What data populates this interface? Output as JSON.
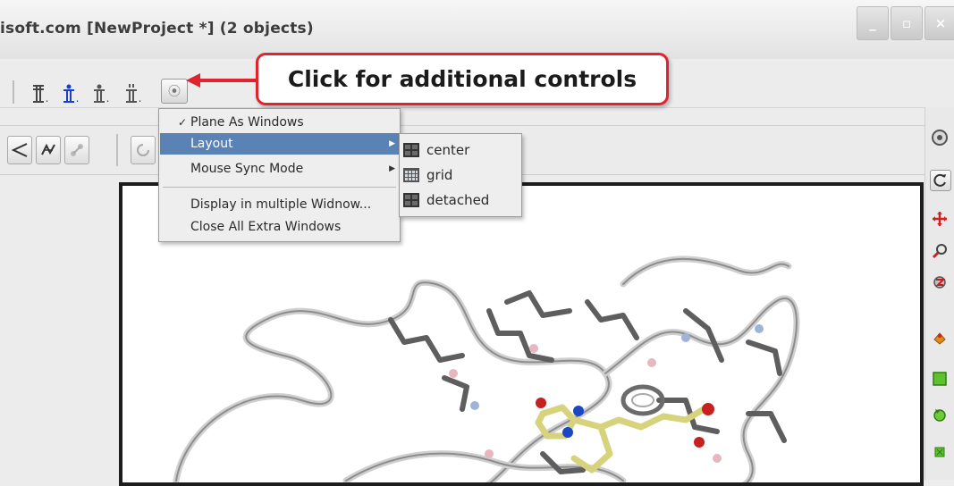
{
  "window": {
    "title": "isoft.com [NewProject *] (2 objects)",
    "buttons": {
      "minimize": "_",
      "maximize": "▫",
      "close": "×"
    }
  },
  "toolbar": {
    "items": [
      {
        "icon": "molecule-display-icon",
        "glyph": "𝕀"
      },
      {
        "icon": "molecule-display-blue-icon",
        "glyph": "𝕀"
      },
      {
        "icon": "molecule-display-2-icon",
        "glyph": "𝕀"
      },
      {
        "icon": "molecule-display-3-icon",
        "glyph": "𝕀"
      }
    ],
    "more_button_icon": "additional-controls-icon"
  },
  "callout": {
    "text": "Click for additional controls",
    "color": "#e0232e"
  },
  "menu": {
    "items": [
      {
        "label": "Plane As Windows",
        "checked": true
      },
      {
        "label": "Layout",
        "submenu": true,
        "highlighted": true
      },
      {
        "label": "Mouse Sync Mode",
        "submenu": true
      },
      {
        "label": "Display in multiple Widnow..."
      },
      {
        "label": "Close All Extra Windows"
      }
    ],
    "check_glyph": "✓",
    "arrow_glyph": "▶"
  },
  "submenu": {
    "items": [
      {
        "label": "center",
        "icon": "layout-center-icon"
      },
      {
        "label": "grid",
        "icon": "layout-grid-icon"
      },
      {
        "label": "detached",
        "icon": "layout-detached-icon"
      }
    ]
  },
  "colors": {
    "highlight": "#5b82b4",
    "accent_red": "#e0232e",
    "toolbar_blue": "#1a3fcf"
  }
}
